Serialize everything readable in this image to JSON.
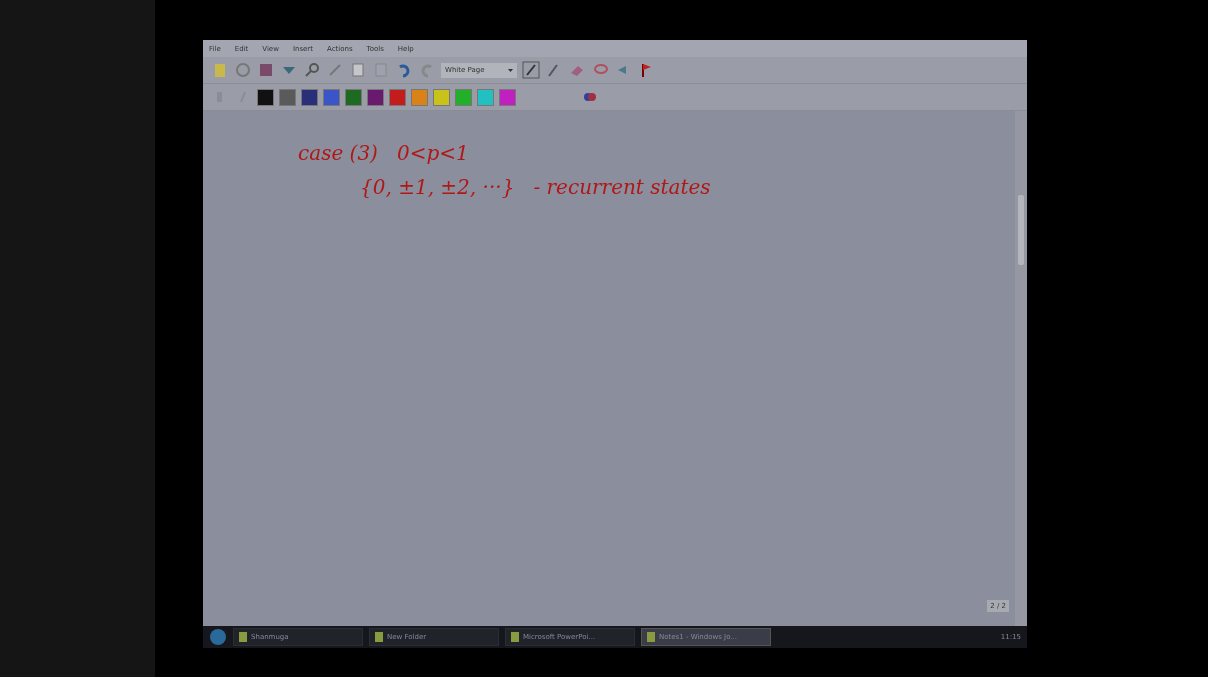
{
  "window": {
    "menu": [
      "File",
      "Edit",
      "View",
      "Insert",
      "Actions",
      "Tools",
      "Help"
    ]
  },
  "toolbar": {
    "page_style": "White Page",
    "swatches": [
      {
        "color": "#111111"
      },
      {
        "color": "#5a5a5a"
      },
      {
        "color": "#2a2f7a"
      },
      {
        "color": "#3b55c8"
      },
      {
        "color": "#1e6a22"
      },
      {
        "color": "#6a1a6e"
      },
      {
        "color": "#c41c1c"
      },
      {
        "color": "#d98218"
      },
      {
        "color": "#c8c21a"
      },
      {
        "color": "#22b02a"
      },
      {
        "color": "#22c0c0"
      },
      {
        "color": "#c020c0"
      }
    ]
  },
  "note": {
    "lines": [
      "case (3)   0<p<1",
      "{0, ±1, ±2, ···}   - recurrent states"
    ],
    "page_counter": "2 / 2"
  },
  "taskbar": {
    "items": [
      {
        "label": "Shanmuga",
        "selected": false
      },
      {
        "label": "New Folder",
        "selected": false
      },
      {
        "label": "Microsoft PowerPoi...",
        "selected": false
      },
      {
        "label": "Notes1 - Windows Jo...",
        "selected": true
      }
    ],
    "clock": "11:15"
  }
}
